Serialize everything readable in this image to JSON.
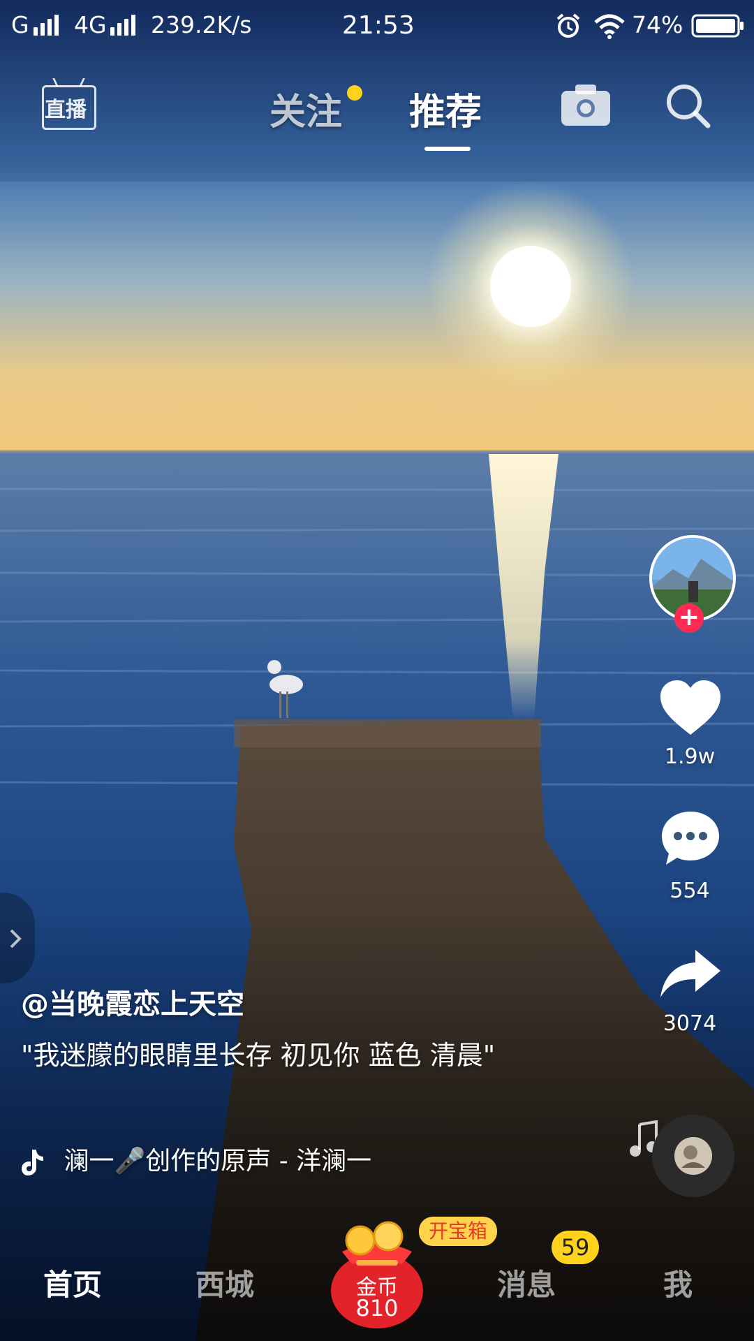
{
  "status_bar": {
    "carrier1": "G",
    "carrier2": "4G",
    "speed": "239.2K/s",
    "time": "21:53",
    "battery": "74%",
    "icons": [
      "signal-icon",
      "alarm-icon",
      "wifi-icon",
      "battery-icon"
    ]
  },
  "top_nav": {
    "live_label": "直播",
    "follow_label": "关注",
    "recommend_label": "推荐",
    "icons": [
      "camera-icon",
      "search-icon"
    ]
  },
  "right_rail": {
    "like_count": "1.9w",
    "comment_count": "554",
    "share_count": "3074",
    "follow_badge": "+",
    "icons": [
      "heart-icon",
      "comment-icon",
      "share-icon",
      "music-note-icon"
    ]
  },
  "video": {
    "author": "@当晚霞恋上天空",
    "caption": "\"我迷朦的眼睛里长存 初见你 蓝色 清晨\"",
    "music": "澜一🎤创作的原声 - 洋澜一"
  },
  "bottom_nav": {
    "home": "首页",
    "city": "西城",
    "coin_label": "金币",
    "coin_count": "810",
    "treasure": "开宝箱",
    "messages": "消息",
    "message_badge": "59",
    "me": "我"
  },
  "colors": {
    "accent_red": "#fe2c55",
    "badge_yellow": "#ffd21d",
    "treasure_bg": "#ffd44a"
  }
}
